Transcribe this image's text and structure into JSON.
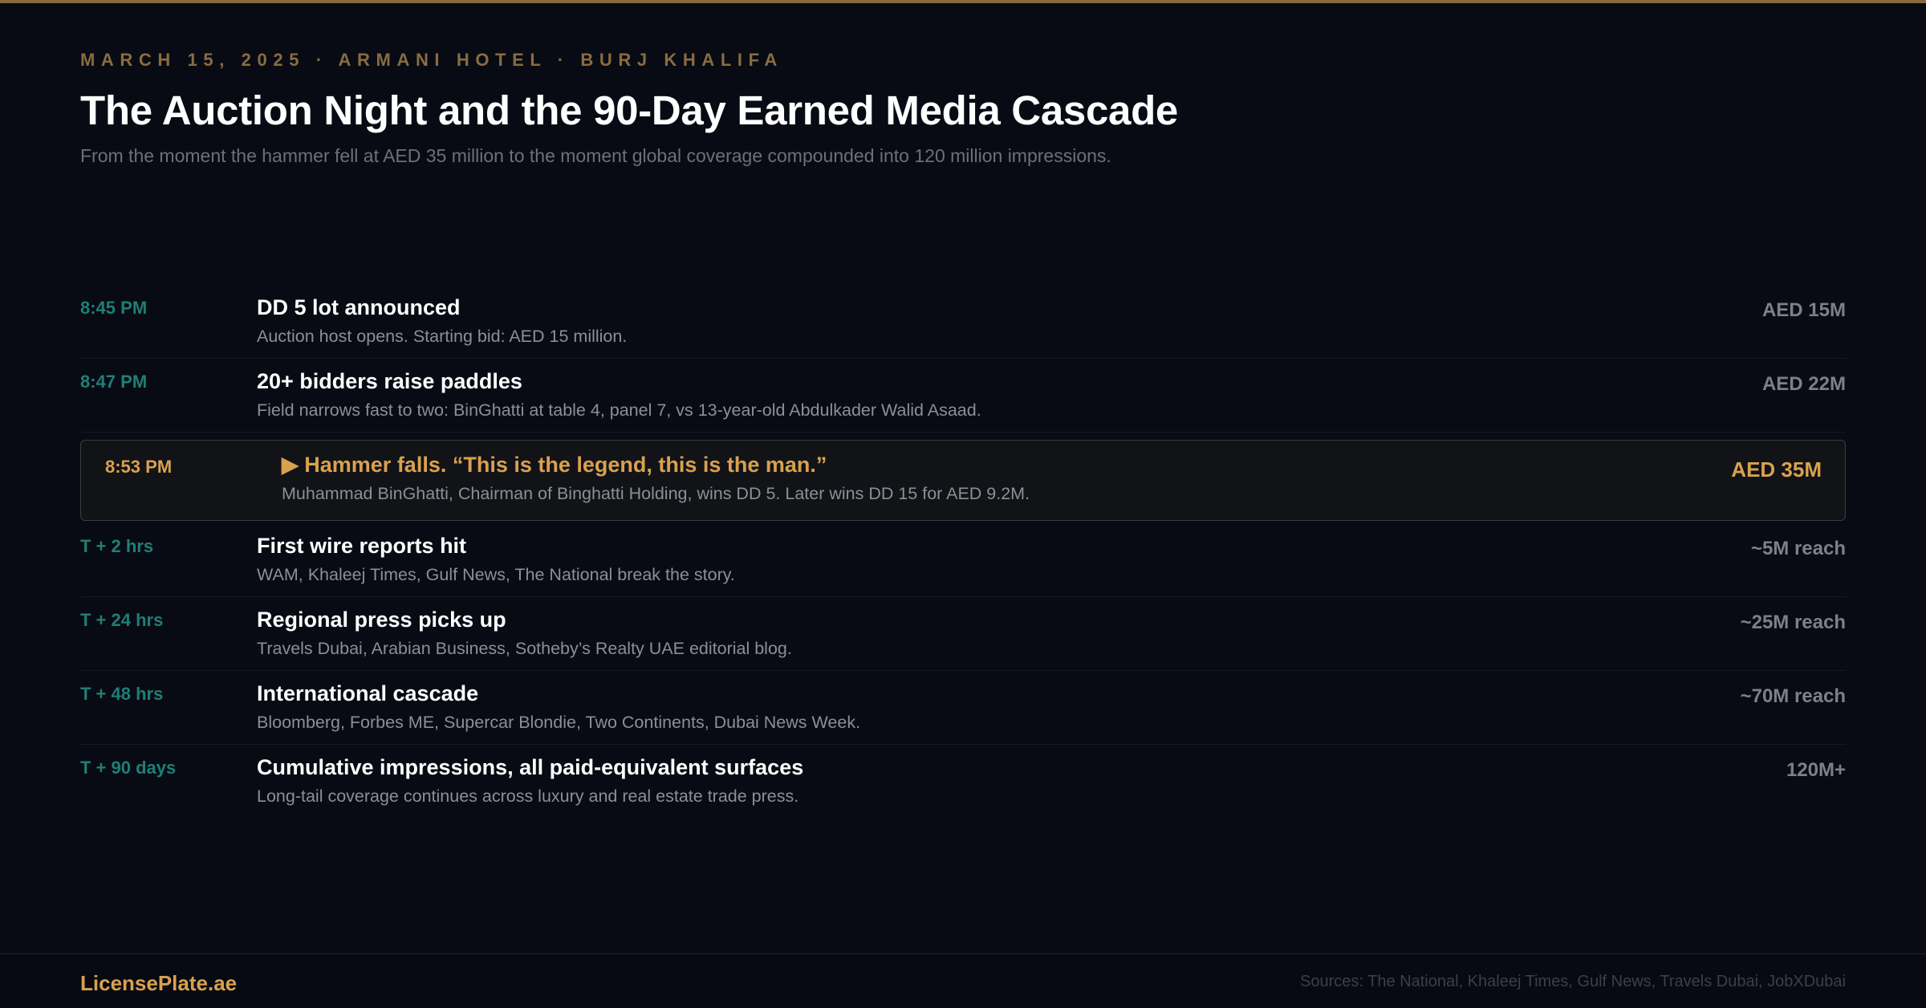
{
  "header": {
    "kicker": "March 15, 2025 · Armani Hotel · Burj Khalifa",
    "title": "The Auction Night and the 90-Day Earned Media Cascade",
    "subtitle": "From the moment the hammer fell at AED 35 million to the moment global coverage compounded into 120 million impressions."
  },
  "timeline": [
    {
      "time": "8:45 PM",
      "title": "DD 5 lot announced",
      "desc": "Auction host opens. Starting bid: AED 15 million.",
      "metric": "AED 15M"
    },
    {
      "time": "8:47 PM",
      "title": "20+ bidders raise paddles",
      "desc": "Field narrows fast to two: BinGhatti at table 4, panel 7, vs 13-year-old Abdulkader Walid Asaad.",
      "metric": "AED 22M"
    },
    {
      "time": "8:53 PM",
      "title": "▶ Hammer falls. “This is the legend, this is the man.”",
      "desc": "Muhammad BinGhatti, Chairman of Binghatti Holding, wins DD 5. Later wins DD 15 for AED 9.2M.",
      "metric": "AED 35M",
      "highlight": true
    },
    {
      "time": "T + 2 hrs",
      "title": "First wire reports hit",
      "desc": "WAM, Khaleej Times, Gulf News, The National break the story.",
      "metric": "~5M reach"
    },
    {
      "time": "T + 24 hrs",
      "title": "Regional press picks up",
      "desc": "Travels Dubai, Arabian Business, Sotheby’s Realty UAE editorial blog.",
      "metric": "~25M reach"
    },
    {
      "time": "T + 48 hrs",
      "title": "International cascade",
      "desc": "Bloomberg, Forbes ME, Supercar Blondie, Two Continents, Dubai News Week.",
      "metric": "~70M reach"
    },
    {
      "time": "T + 90 days",
      "title": "Cumulative impressions, all paid-equivalent surfaces",
      "desc": "Long-tail coverage continues across luxury and real estate trade press.",
      "metric": "120M+"
    }
  ],
  "footer": {
    "brand": "LicensePlate.ae",
    "sources": "Sources: The National, Khaleej Times, Gulf News, Travels Dubai, JobXDubai"
  },
  "colors": {
    "accent_gold": "#d9a14f",
    "time_teal": "#1f7f75",
    "background": "#080b14"
  }
}
